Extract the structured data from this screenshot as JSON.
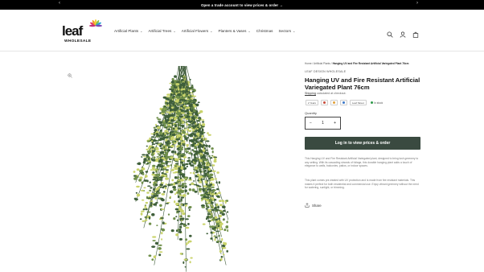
{
  "announcement": {
    "text": "Open a trade account to view prices & order →",
    "prev": "‹",
    "next": "›"
  },
  "brand": {
    "logo_main": "leaf",
    "logo_sub": "WHOLESALE"
  },
  "nav": [
    {
      "label": "Artificial Plants",
      "chevron": "⌄"
    },
    {
      "label": "Artificial Trees",
      "chevron": "⌄"
    },
    {
      "label": "Artificial Flowers",
      "chevron": "⌄"
    },
    {
      "label": "Planters & Vases",
      "chevron": "⌄"
    },
    {
      "label": "Christmas",
      "chevron": ""
    },
    {
      "label": "Sectors",
      "chevron": "⌄"
    }
  ],
  "header_icons": [
    "search-icon",
    "account-icon",
    "cart-icon"
  ],
  "breadcrumb": {
    "home": "Home",
    "sep": " / ",
    "category": "Artificial Plants",
    "current": "Hanging UV and Fire Resistant Artificial Variegated Plant 76cm"
  },
  "product": {
    "vendor": "LEAF DESIGN WHOLESALE",
    "title": "Hanging UV and Fire Resistant Artificial Variegated Plant 76cm",
    "shipping_link": "Shipping",
    "shipping_rest": " calculated at checkout.",
    "swatches": [
      {
        "label": "2 Years",
        "type": "text"
      },
      {
        "label": "",
        "type": "dot",
        "color": "#c94b3b"
      },
      {
        "label": "",
        "type": "dot",
        "color": "#e2a23a"
      },
      {
        "label": "",
        "type": "dot",
        "color": "#3b78c9"
      },
      {
        "label": "Leaf Street",
        "type": "text"
      }
    ],
    "stock": "In stock",
    "stock_color": "#2f9a4a",
    "quantity_label": "Quantity",
    "quantity_value": "1",
    "qty_minus": "−",
    "qty_plus": "+",
    "cta": "Log in to view prices & order",
    "description_1": "This Hanging UV and Fire Resistant Artificial Variegated plant, designed to bring lush greenery to any setting. With its cascading strands of foliage, this durable hanging plant adds a touch of elegance to walls, balconies, patios, or indoor spaces.",
    "description_2": "This plant comes pre-treated with UV protection and is made from fire resistant materials. This makes it perfect for both residential and commercial use. Enjoy vibrant greenery without the need for watering, sunlight, or trimming.",
    "share": "Share"
  },
  "colors": {
    "accent": "#3a4a40",
    "announce_bg": "#000000"
  }
}
